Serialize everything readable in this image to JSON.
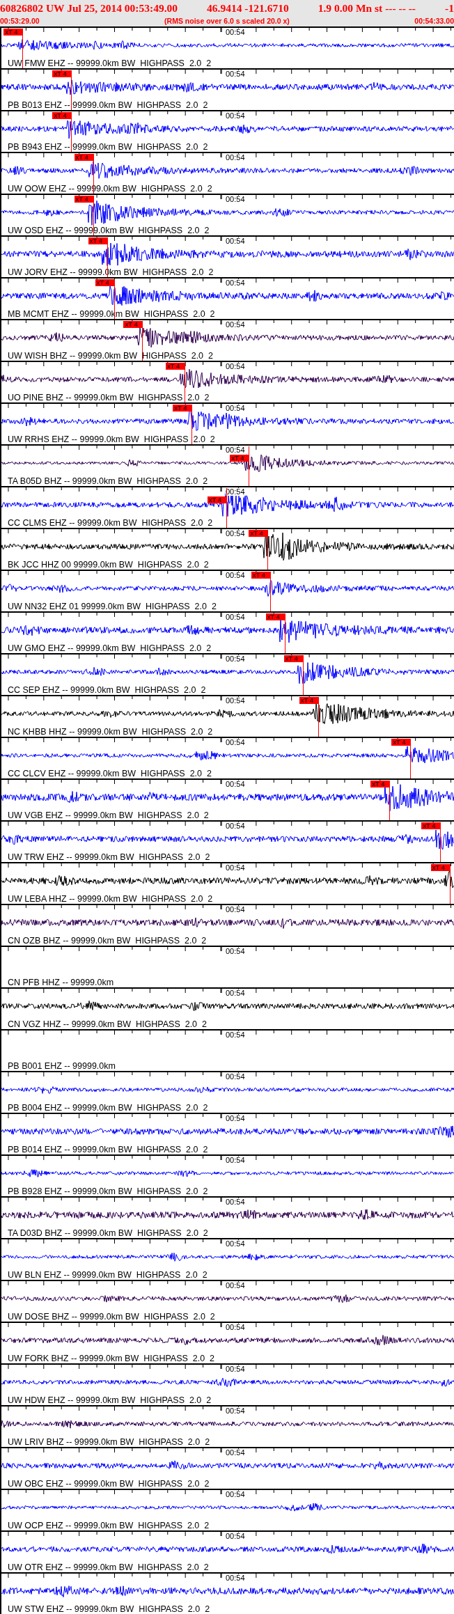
{
  "header": {
    "event_line": [
      "60826802 UW Jul 25, 2014 00:53:49.00",
      "46.9414 -121.6710",
      "1.9 0.00 Mn st --- -- --",
      "-1"
    ],
    "start_time": "00:53:29.00",
    "note": "(RMS noise over 6.0 s scaled 20.0 x)",
    "end_time": "00:54:33.00"
  },
  "traces": [
    {
      "label": "UW FMW EHZ -- 99999.0km BW  HIGHPASS  2.0  2",
      "time_label": "00:54",
      "color": "#0000ff",
      "has_signal": true,
      "pick": {
        "label": "xT 4",
        "level": 0.048
      }
    },
    {
      "label": "PB B013 EHZ -- 99999.0km BW  HIGHPASS  2.0  2",
      "time_label": "00:54",
      "color": "#0000ff",
      "has_signal": true,
      "pick": {
        "label": "xT 4",
        "level": 0.156
      }
    },
    {
      "label": "PB B943 EHZ -- 99999.0km BW  HIGHPASS  2.0  2",
      "time_label": "00:54",
      "color": "#0000ff",
      "has_signal": true,
      "pick": {
        "label": "xT 4",
        "level": 0.156
      }
    },
    {
      "label": "UW OOW EHZ -- 99999.0km BW  HIGHPASS  2.0  2",
      "time_label": "00:54",
      "color": "#0000ff",
      "has_signal": true,
      "pick": {
        "label": "xT 4",
        "level": 0.204
      }
    },
    {
      "label": "UW OSD EHZ -- 99999.0km BW  HIGHPASS  2.0  2",
      "time_label": "00:54",
      "color": "#0000ff",
      "has_signal": true,
      "pick": {
        "label": "xT 4",
        "level": 0.204
      }
    },
    {
      "label": "UW JORV EHZ -- 99999.0km BW  HIGHPASS  2.0  2",
      "time_label": "00:54",
      "color": "#0000ff",
      "has_signal": true,
      "pick": {
        "label": "xT 4",
        "level": 0.235
      }
    },
    {
      "label": "MB MCMT EHZ -- 99999.0km BW  HIGHPASS  2.0  2",
      "time_label": "00:54",
      "color": "#0000ff",
      "has_signal": true,
      "pick": {
        "label": "xT 4",
        "level": 0.25
      }
    },
    {
      "label": "UW WISH BHZ -- 99999.0km BW  HIGHPASS  2.0  2",
      "time_label": "00:54",
      "color": "#300050",
      "has_signal": true,
      "pick": {
        "label": "xT 4",
        "level": 0.313
      }
    },
    {
      "label": "UO PINE BHZ -- 99999.0km BW  HIGHPASS  2.0  2",
      "time_label": "00:54",
      "color": "#300050",
      "has_signal": true,
      "pick": {
        "label": "xT 4",
        "level": 0.406
      }
    },
    {
      "label": "UW RRHS EHZ -- 99999.0km BW  HIGHPASS  2.0  2",
      "time_label": "00:54",
      "color": "#0000ff",
      "has_signal": true,
      "pick": {
        "label": "xT 4",
        "level": 0.422
      }
    },
    {
      "label": "TA B05D BHZ -- 99999.0km BW  HIGHPASS  2.0  2",
      "time_label": "00:54",
      "color": "#300050",
      "has_signal": true,
      "pick": {
        "label": "xT 4",
        "level": 0.548
      }
    },
    {
      "label": "CC CLMS EHZ -- 99999.0km BW  HIGHPASS  2.0  2",
      "time_label": "00:54",
      "color": "#0000ff",
      "has_signal": true,
      "pick": {
        "label": "xT 4",
        "level": 0.498
      }
    },
    {
      "label": "BK JCC HHZ 00 99999.0km BW  HIGHPASS  2.0  2",
      "time_label": "00:54",
      "color": "#000000",
      "has_signal": true,
      "pick": {
        "label": "xT 4",
        "level": 0.59
      }
    },
    {
      "label": "UW NN32 EHZ 01 99999.0km BW  HIGHPASS  2.0  2",
      "time_label": "00:54",
      "color": "#0000ff",
      "has_signal": true,
      "pick": {
        "label": "xT 4",
        "level": 0.595
      }
    },
    {
      "label": "UW GMO EHZ -- 99999.0km BW  HIGHPASS  2.0  2",
      "time_label": "00:54",
      "color": "#0000ff",
      "has_signal": true,
      "pick": {
        "label": "xT 4",
        "level": 0.627
      }
    },
    {
      "label": "CC SEP EHZ -- 99999.0km BW  HIGHPASS  2.0  2",
      "time_label": "00:54",
      "color": "#0000ff",
      "has_signal": true,
      "pick": {
        "label": "xT 4",
        "level": 0.667
      }
    },
    {
      "label": "NC KHBB HHZ -- 99999.0km BW  HIGHPASS  2.0  2",
      "time_label": "00:54",
      "color": "#000000",
      "has_signal": true,
      "pick": {
        "label": "xT 4",
        "level": 0.701
      }
    },
    {
      "label": "CC CLCV EHZ -- 99999.0km BW  HIGHPASS  2.0  2",
      "time_label": "00:54",
      "color": "#0000ff",
      "has_signal": true,
      "pick": {
        "label": "xT 4",
        "level": 0.905
      }
    },
    {
      "label": "UW VGB EHZ -- 99999.0km BW  HIGHPASS  2.0  2",
      "time_label": "00:54",
      "color": "#0000ff",
      "has_signal": true,
      "pick": {
        "label": "xT 4",
        "level": 0.859
      }
    },
    {
      "label": "UW TRW EHZ -- 99999.0km BW  HIGHPASS  2.0  2",
      "time_label": "00:54",
      "color": "#0000ff",
      "has_signal": true,
      "pick": {
        "label": "xT 4",
        "level": 0.971
      }
    },
    {
      "label": "UW LEBA HHZ -- 99999.0km BW  HIGHPASS  2.0  2",
      "time_label": "00:54",
      "color": "#000000",
      "has_signal": true,
      "pick": {
        "label": "xT 4",
        "level": 0.992
      }
    },
    {
      "label": "CN OZB BHZ -- 99999.0km BW  HIGHPASS  2.0  2",
      "time_label": "00:54",
      "color": "#300050",
      "has_signal": true
    },
    {
      "label": "CN PFB HHZ -- 99999.0km",
      "time_label": "00:54",
      "has_signal": false
    },
    {
      "label": "CN VGZ HHZ -- 99999.0km BW  HIGHPASS  2.0  2",
      "time_label": "00:54",
      "color": "#000000",
      "has_signal": true
    },
    {
      "label": "PB B001 EHZ -- 99999.0km",
      "time_label": "00:54",
      "has_signal": false
    },
    {
      "label": "PB B004 EHZ -- 99999.0km BW  HIGHPASS  2.0  2",
      "time_label": "00:54",
      "color": "#0000ff",
      "has_signal": true
    },
    {
      "label": "PB B014 EHZ -- 99999.0km BW  HIGHPASS  2.0  2",
      "time_label": "00:54",
      "color": "#0000ff",
      "has_signal": true
    },
    {
      "label": "PB B928 EHZ -- 99999.0km BW  HIGHPASS  2.0  2",
      "time_label": "00:54",
      "color": "#0000ff",
      "has_signal": true
    },
    {
      "label": "TA D03D BHZ -- 99999.0km BW  HIGHPASS  2.0  2",
      "time_label": "00:54",
      "color": "#300050",
      "has_signal": true
    },
    {
      "label": "UW BLN EHZ -- 99999.0km BW  HIGHPASS  2.0  2",
      "time_label": "00:54",
      "color": "#0000ff",
      "has_signal": true
    },
    {
      "label": "UW DOSE BHZ -- 99999.0km BW  HIGHPASS  2.0  2",
      "time_label": "00:54",
      "color": "#300050",
      "has_signal": true
    },
    {
      "label": "UW FORK BHZ -- 99999.0km BW  HIGHPASS  2.0  2",
      "time_label": "00:54",
      "color": "#300050",
      "has_signal": true
    },
    {
      "label": "UW HDW EHZ -- 99999.0km BW  HIGHPASS  2.0  2",
      "time_label": "00:54",
      "color": "#0000ff",
      "has_signal": true
    },
    {
      "label": "UW LRIV BHZ -- 99999.0km BW  HIGHPASS  2.0  2",
      "time_label": "00:54",
      "color": "#300050",
      "has_signal": true
    },
    {
      "label": "UW OBC EHZ -- 99999.0km BW  HIGHPASS  2.0  2",
      "time_label": "00:54",
      "color": "#0000ff",
      "has_signal": true
    },
    {
      "label": "UW OCP EHZ -- 99999.0km BW  HIGHPASS  2.0  2",
      "time_label": "00:54",
      "color": "#0000ff",
      "has_signal": true
    },
    {
      "label": "UW OTR EHZ -- 99999.0km BW  HIGHPASS  2.0  2",
      "time_label": "00:54",
      "color": "#0000ff",
      "has_signal": true
    },
    {
      "label": "UW STW EHZ -- 99999.0km BW  HIGHPASS  2.0  2",
      "time_label": "00:54",
      "color": "#0000ff",
      "has_signal": true
    }
  ]
}
